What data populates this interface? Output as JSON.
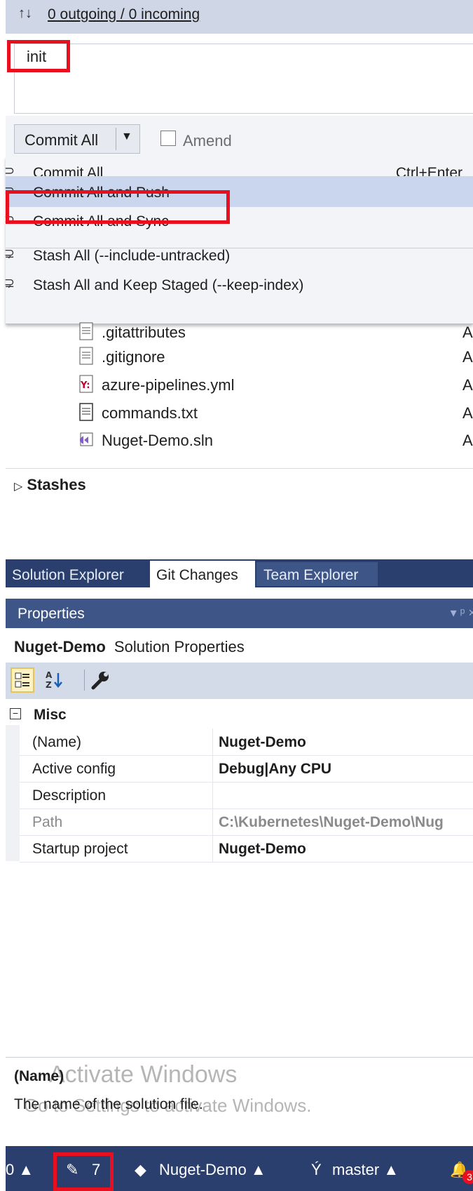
{
  "sync": {
    "arrows": "↑↓",
    "label": "0 outgoing / 0 incoming"
  },
  "commit_message": "init",
  "commit_button": {
    "label": "Commit All",
    "caret": "▼"
  },
  "amend": {
    "label": "Amend",
    "checked": false
  },
  "menu": {
    "items": [
      {
        "label": "Commit All",
        "shortcut": "Ctrl+Enter",
        "icon": "commit-icon"
      },
      {
        "label": "Commit All and Push",
        "shortcut": "",
        "icon": "commit-push-icon",
        "highlighted": true
      },
      {
        "label": "Commit All and Sync",
        "shortcut": "",
        "icon": "commit-sync-icon"
      },
      {
        "label": "Stash All (--include-untracked)",
        "shortcut": "",
        "icon": "stash-icon"
      },
      {
        "label": "Stash All and Keep Staged (--keep-index)",
        "shortcut": "",
        "icon": "stash-keep-icon"
      }
    ]
  },
  "files": [
    {
      "name": ".gitattributes",
      "status": "A",
      "icon": "text-file-icon"
    },
    {
      "name": ".gitignore",
      "status": "A",
      "icon": "text-file-icon"
    },
    {
      "name": "azure-pipelines.yml",
      "status": "A",
      "icon": "yaml-file-icon"
    },
    {
      "name": "commands.txt",
      "status": "A",
      "icon": "text-file-icon"
    },
    {
      "name": "Nuget-Demo.sln",
      "status": "A",
      "icon": "solution-file-icon"
    }
  ],
  "stashes_label": "Stashes",
  "tabs": [
    {
      "label": "Solution Explorer",
      "active": false
    },
    {
      "label": "Git Changes",
      "active": true
    },
    {
      "label": "Team Explorer",
      "active": false
    }
  ],
  "properties": {
    "title": "Properties",
    "header_icons": "▾ ᵖ ×",
    "subject_name": "Nuget-Demo",
    "subject_type": "Solution Properties",
    "category": "Misc",
    "rows": [
      {
        "name": "(Name)",
        "value": "Nuget-Demo",
        "dim": false
      },
      {
        "name": "Active config",
        "value": "Debug|Any CPU",
        "dim": false
      },
      {
        "name": "Description",
        "value": "",
        "dim": false
      },
      {
        "name": "Path",
        "value": "C:\\Kubernetes\\Nuget-Demo\\Nug",
        "dim": true
      },
      {
        "name": "Startup project",
        "value": "Nuget-Demo",
        "dim": false
      }
    ],
    "description_title": "(Name)",
    "description_text": "The name of the solution file."
  },
  "watermark": {
    "line1": "Activate Windows",
    "line2": "Go to Settings to activate Windows."
  },
  "statusbar": {
    "left_arrow": "0 ▲",
    "pending_changes": "7",
    "repo": "Nuget-Demo ▲",
    "branch": "master ▲",
    "notifications": "3"
  },
  "colors": {
    "accent_red": "#e8101e",
    "tab_strip": "#2b3f6e",
    "props_header": "#3e5588",
    "menu_highlight": "#cad5ee"
  }
}
